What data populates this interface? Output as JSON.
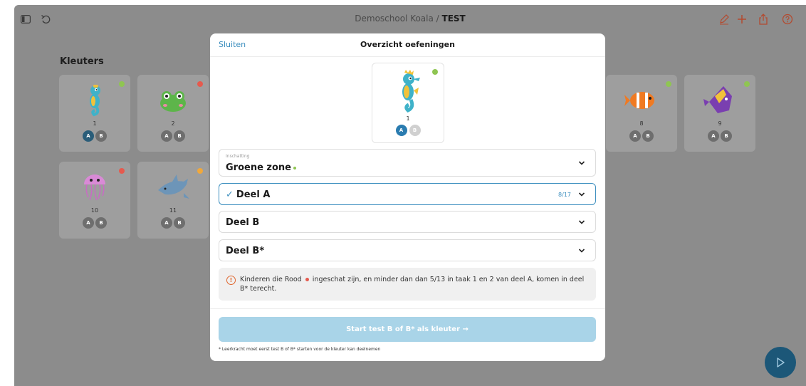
{
  "topbar": {
    "school": "Demoschool Koala",
    "separator": " / ",
    "test": "TEST"
  },
  "section_title": "Kleuters",
  "cards": [
    {
      "number": "1",
      "status": "green",
      "animal": "seahorse-icon",
      "a_active": true
    },
    {
      "number": "2",
      "status": "red",
      "animal": "frog-icon",
      "a_active": false
    },
    {
      "number": "8",
      "status": "green",
      "animal": "clownfish-icon",
      "a_active": false
    },
    {
      "number": "9",
      "status": "green",
      "animal": "angelfish-icon",
      "a_active": false
    },
    {
      "number": "10",
      "status": "red",
      "animal": "jellyfish-icon",
      "a_active": false
    },
    {
      "number": "11",
      "status": "orange",
      "animal": "dolphin-icon",
      "a_active": false
    }
  ],
  "pill_labels": {
    "a": "A",
    "b": "B"
  },
  "modal": {
    "close_label": "Sluiten",
    "title": "Overzicht oefeningen",
    "preview": {
      "number": "1",
      "status": "green"
    },
    "inschatting": {
      "label": "Inschatting",
      "value": "Groene zone"
    },
    "deel_a": {
      "check": "✓",
      "label": "Deel A",
      "count": "8/17"
    },
    "deel_b": {
      "label": "Deel B"
    },
    "deel_bs": {
      "label": "Deel B*"
    },
    "info": {
      "icon": "!",
      "text_before": "Kinderen die Rood",
      "text_after": "ingeschat zijn, en minder dan dan 5/13 in taak 1 en 2 van deel A, komen in deel B* terecht."
    },
    "start_button": "Start test B of B* als kleuter →",
    "footnote": "* Leerkracht moet eerst test B of B* starten voor de kleuter kan deelnemen"
  },
  "colors": {
    "green": "#8fc552",
    "red": "#e55a4e",
    "orange": "#f0a83c",
    "accent": "#3d8fbf",
    "overlay": "#8c8c8c"
  }
}
